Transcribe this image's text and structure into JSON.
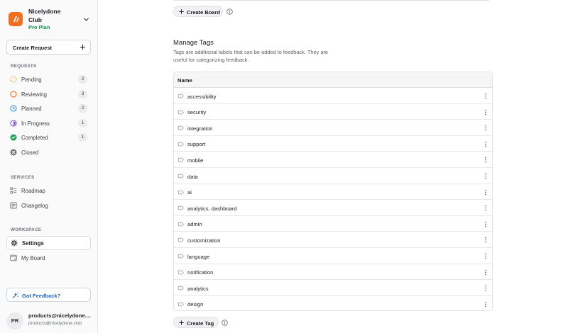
{
  "brand": {
    "name": "Nicelydone Club",
    "plan": "Pro Plan",
    "logo_color": "#f26f21",
    "plan_color": "#17934a"
  },
  "sidebar": {
    "create_request_label": "Create Request",
    "requests_title": "REQUESTS",
    "requests": [
      {
        "label": "Pending",
        "count": "2",
        "icon": "pending-icon",
        "color": "#f5a524"
      },
      {
        "label": "Reviewing",
        "count": "3",
        "icon": "reviewing-icon",
        "color": "#f07a28"
      },
      {
        "label": "Planned",
        "count": "2",
        "icon": "planned-icon",
        "color": "#2f8fd8"
      },
      {
        "label": "In Progress",
        "count": "1",
        "icon": "in-progress-icon",
        "color": "#7e4ad8"
      },
      {
        "label": "Completed",
        "count": "1",
        "icon": "completed-icon",
        "color": "#1fa256"
      },
      {
        "label": "Closed",
        "icon": "closed-icon",
        "color": "#72767c"
      }
    ],
    "services_title": "SERVICES",
    "services": [
      {
        "label": "Roadmap",
        "icon": "roadmap-icon"
      },
      {
        "label": "Changelog",
        "icon": "changelog-icon"
      }
    ],
    "workspace_title": "WORKSPACE",
    "workspace": [
      {
        "label": "Settings",
        "icon": "gear-icon",
        "active": true
      },
      {
        "label": "My Board",
        "icon": "board-icon"
      }
    ],
    "feedback_label": "Got Feedback?",
    "user": {
      "initials": "PR",
      "name": "products@nicelydone....",
      "email": "products@nicelydone.club"
    }
  },
  "main": {
    "create_board_label": "Create Board",
    "tags_section": {
      "title": "Manage Tags",
      "description": "Tags are additional labels that can be added to feedback. They are useful for categorizing feedback.",
      "column_name": "Name",
      "tags": [
        "accessibility",
        "security",
        "integration",
        "support",
        "mobile",
        "data",
        "ai",
        "analytics, dashboard",
        "admin",
        "customization",
        "language",
        "notification",
        "analytics",
        "design"
      ],
      "create_tag_label": "Create Tag"
    }
  }
}
